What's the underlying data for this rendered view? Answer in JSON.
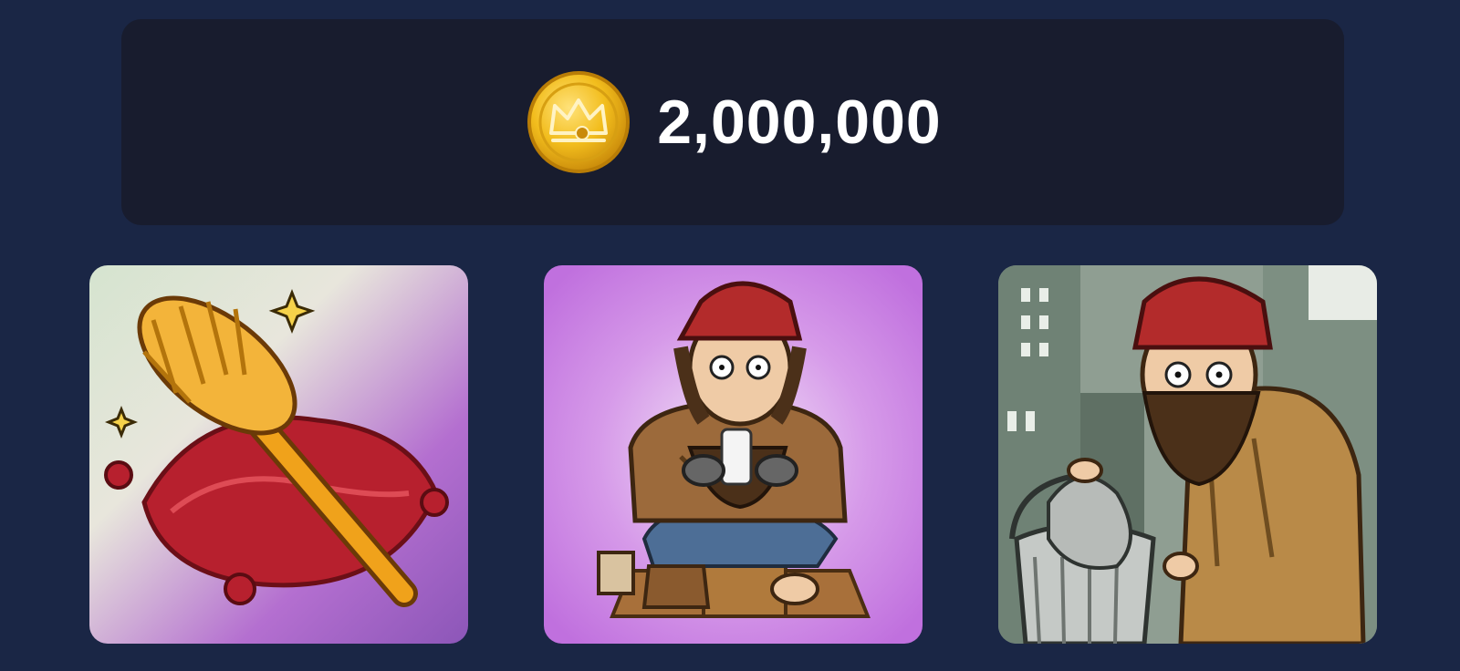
{
  "balance": {
    "value": "2,000,000",
    "icon": "crown-coin-icon",
    "coin_color": "#f2bd1d"
  },
  "colors": {
    "background": "#1a2645",
    "panel": "#181c2e",
    "text": "#ffffff"
  },
  "cards": [
    {
      "icon": "toilet-brush-on-cushion-icon",
      "bg": "#b46fd0"
    },
    {
      "icon": "homeless-man-with-phone-icon",
      "bg": "#c87ae0"
    },
    {
      "icon": "homeless-man-with-trash-can-icon",
      "bg": "#8f9e92"
    }
  ]
}
